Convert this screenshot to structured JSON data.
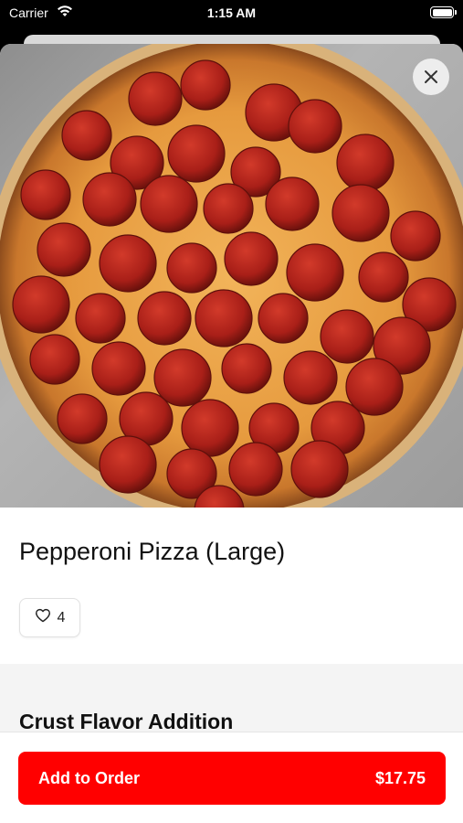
{
  "status_bar": {
    "carrier": "Carrier",
    "time": "1:15 AM",
    "wifi_icon": "wifi-icon",
    "battery_icon": "battery-icon"
  },
  "hero": {
    "image": "pepperoni-pizza-photo",
    "close_icon": "close-icon"
  },
  "item": {
    "title": "Pepperoni Pizza (Large)",
    "like_icon": "heart-icon",
    "like_count": "4"
  },
  "options": {
    "section_title": "Crust Flavor Addition"
  },
  "footer": {
    "button_label": "Add to Order",
    "price": "$17.75"
  },
  "colors": {
    "accent": "#ff0000",
    "section_background": "#f4f4f4",
    "pizza_cheese": "#e8a24a",
    "pepperoni": "#b7241d"
  }
}
